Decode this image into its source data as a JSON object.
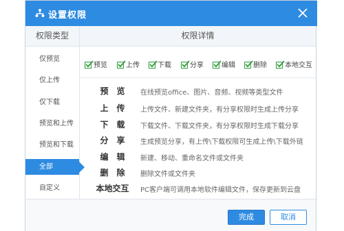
{
  "dialog": {
    "title": "设置权限",
    "title_icon": "org-tree-icon",
    "close_icon": "close-icon"
  },
  "headers": {
    "left": "权限类型",
    "right": "权限详情"
  },
  "sidebar": {
    "items": [
      {
        "label": "仅预览"
      },
      {
        "label": "仅上传"
      },
      {
        "label": "仅下载"
      },
      {
        "label": "预览和上传"
      },
      {
        "label": "预览和下载"
      },
      {
        "label": "全部",
        "active": true
      },
      {
        "label": "自定义"
      }
    ]
  },
  "checkboxes": [
    {
      "label": "预览",
      "checked": true
    },
    {
      "label": "上传",
      "checked": true
    },
    {
      "label": "下载",
      "checked": true
    },
    {
      "label": "分享",
      "checked": true
    },
    {
      "label": "编辑",
      "checked": true
    },
    {
      "label": "删除",
      "checked": true
    },
    {
      "label": "本地交互",
      "checked": true
    }
  ],
  "details": [
    {
      "name": "预　览",
      "desc": "在线预览office、图片、音频、视频等类型文件"
    },
    {
      "name": "上　传",
      "desc": "上传文件、新建文件夹，有分享权限时生成上传分享"
    },
    {
      "name": "下　载",
      "desc": "下载文件、下载文件夹，有分享权限时生成下载分享"
    },
    {
      "name": "分　享",
      "desc": "生成预览分享，有上传\\下载权限可生成上传\\下载外链"
    },
    {
      "name": "编　辑",
      "desc": "新建、移动、重命名文件或文件夹"
    },
    {
      "name": "删　除",
      "desc": "删除文件或文件夹"
    },
    {
      "name": "本地交互",
      "desc": "PC客户端可调用本地软件编辑文件，保存更新到云盘"
    }
  ],
  "footer": {
    "ok_label": "完成",
    "cancel_label": "取消"
  },
  "colors": {
    "accent": "#2e8be2",
    "check": "#2e9b3c"
  }
}
